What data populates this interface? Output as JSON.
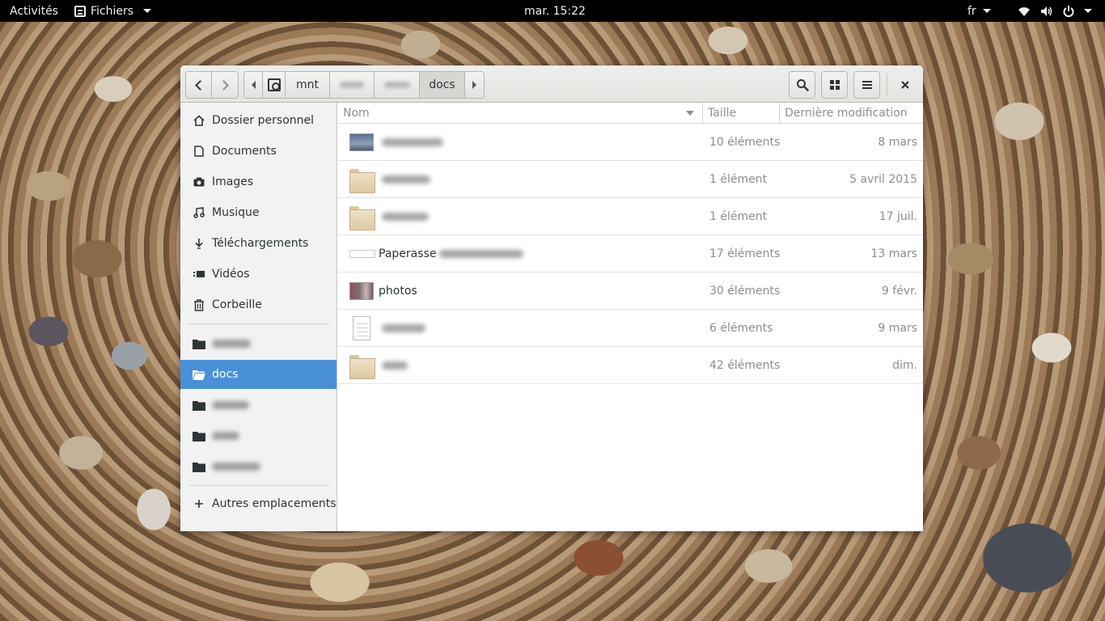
{
  "topbar": {
    "activities": "Activités",
    "app_name": "Fichiers",
    "clock": "mar. 15:22",
    "language": "fr"
  },
  "window": {
    "pathbar": {
      "segments": [
        "mnt",
        "docs"
      ],
      "current": "docs"
    },
    "sidebar": {
      "places": [
        {
          "label": "Dossier personnel",
          "icon": "home-icon"
        },
        {
          "label": "Documents",
          "icon": "document-icon"
        },
        {
          "label": "Images",
          "icon": "camera-icon"
        },
        {
          "label": "Musique",
          "icon": "music-icon"
        },
        {
          "label": "Téléchargements",
          "icon": "download-icon"
        },
        {
          "label": "Vidéos",
          "icon": "video-icon"
        },
        {
          "label": "Corbeille",
          "icon": "trash-icon"
        }
      ],
      "bookmarks": [
        {
          "label": "",
          "icon": "folder-icon"
        },
        {
          "label": "docs",
          "icon": "folder-icon",
          "selected": true
        },
        {
          "label": "",
          "icon": "folder-icon"
        },
        {
          "label": "",
          "icon": "folder-icon"
        },
        {
          "label": "",
          "icon": "folder-icon"
        }
      ],
      "other_locations": "Autres emplacements",
      "selected_color": "#4a90d9"
    },
    "list": {
      "columns": {
        "name": "Nom",
        "size": "Taille",
        "modified": "Dernière modification"
      },
      "rows": [
        {
          "name": "",
          "thumb": "image",
          "size": "10 éléments",
          "modified": "8 mars"
        },
        {
          "name": "",
          "thumb": "folder",
          "size": "1 élément",
          "modified": "5 avril 2015"
        },
        {
          "name": "",
          "thumb": "folder",
          "size": "1 élément",
          "modified": "17 juil."
        },
        {
          "name": "Paperasse",
          "thumb": "wide",
          "size": "17 éléments",
          "modified": "13 mars"
        },
        {
          "name": "photos",
          "thumb": "photo",
          "size": "30 éléments",
          "modified": "9 févr."
        },
        {
          "name": "",
          "thumb": "document",
          "size": "6 éléments",
          "modified": "9 mars"
        },
        {
          "name": "",
          "thumb": "folder",
          "size": "42 éléments",
          "modified": "dim."
        }
      ]
    }
  }
}
